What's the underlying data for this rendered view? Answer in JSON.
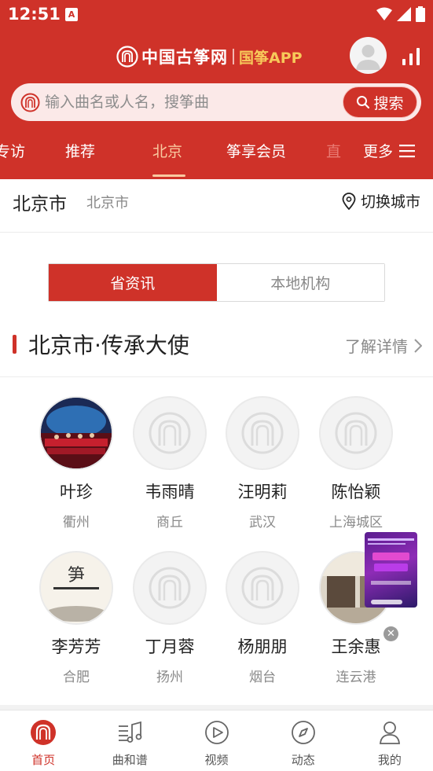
{
  "status_bar": {
    "time": "12:51"
  },
  "header": {
    "logo_text": "中国古筝网",
    "logo_app": "国筝APP"
  },
  "search": {
    "placeholder": "输入曲名或人名，搜筝曲",
    "button_label": "搜索"
  },
  "tabs": [
    {
      "label": "专访"
    },
    {
      "label": "推荐"
    },
    {
      "label": "北京",
      "active": true
    },
    {
      "label": "筝享会员"
    },
    {
      "label": "直"
    }
  ],
  "tabs_more": "更多",
  "city": {
    "name": "北京市",
    "sub": "北京市",
    "switch_label": "切换城市"
  },
  "segments": [
    {
      "label": "省资讯",
      "active": true
    },
    {
      "label": "本地机构"
    }
  ],
  "section": {
    "title": "北京市·传承大使",
    "more": "了解详情"
  },
  "ambassadors": [
    {
      "name": "叶珍",
      "city": "衢州"
    },
    {
      "name": "韦雨晴",
      "city": "商丘"
    },
    {
      "name": "汪明莉",
      "city": "武汉"
    },
    {
      "name": "陈怡颖",
      "city": "上海城区"
    },
    {
      "name": "李芳芳",
      "city": "合肥"
    },
    {
      "name": "丁月蓉",
      "city": "扬州"
    },
    {
      "name": "杨朋朋",
      "city": "烟台"
    },
    {
      "name": "王余惠",
      "city": "连云港"
    }
  ],
  "bottom_nav": [
    {
      "label": "首页",
      "icon": "home-logo-icon",
      "active": true
    },
    {
      "label": "曲和谱",
      "icon": "music-score-icon"
    },
    {
      "label": "视频",
      "icon": "play-circle-icon"
    },
    {
      "label": "动态",
      "icon": "compass-icon"
    },
    {
      "label": "我的",
      "icon": "user-icon"
    }
  ],
  "colors": {
    "brand_red": "#cf3229",
    "accent_gold": "#f7c95a",
    "tab_active": "#f9c9a0"
  }
}
